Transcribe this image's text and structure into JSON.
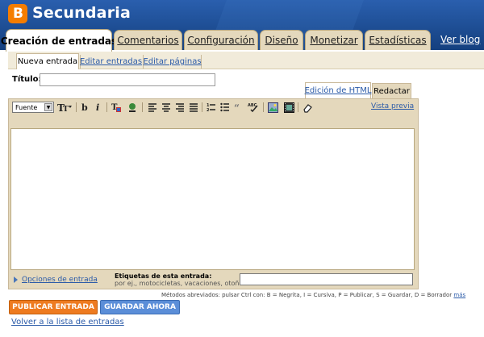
{
  "header": {
    "title": "Secundaria",
    "logo_letter": "B",
    "tabs": [
      {
        "label": "Creación de entradas"
      },
      {
        "label": "Comentarios"
      },
      {
        "label": "Configuración"
      },
      {
        "label": "Diseño"
      },
      {
        "label": "Monetizar"
      },
      {
        "label": "Estadísticas"
      }
    ],
    "view_blog": "Ver blog"
  },
  "subtabs": [
    {
      "label": "Nueva entrada"
    },
    {
      "label": "Editar entradas"
    },
    {
      "label": "Editar páginas"
    }
  ],
  "form": {
    "title_label": "Título:",
    "title_value": ""
  },
  "editor": {
    "mode_tabs": [
      "Edición de HTML",
      "Redactar"
    ],
    "font_select": "Fuente",
    "preview_link": "Vista previa",
    "toolbar_icons": [
      "text-size-icon",
      "bold-icon",
      "italic-icon",
      "text-color-icon",
      "highlight-icon",
      "align-left-icon",
      "align-center-icon",
      "align-right-icon",
      "justify-icon",
      "numbered-list-icon",
      "bullet-list-icon",
      "blockquote-icon",
      "spellcheck-icon",
      "image-icon",
      "video-icon",
      "eraser-icon"
    ]
  },
  "options": {
    "toggle_label": "Opciones de entrada",
    "labels_title": "Etiquetas de esta entrada:",
    "labels_hint": "por ej., motocicletas, vacaciones, otoño",
    "labels_value": ""
  },
  "shortcuts": {
    "text": "Métodos abreviados: pulsar Ctrl con: B = Negrita, I = Cursiva, P = Publicar, S = Guardar, D = Borrador",
    "more": "más"
  },
  "actions": {
    "publish": "PUBLICAR ENTRADA",
    "save": "GUARDAR AHORA",
    "back": "Volver a la lista de entradas"
  },
  "colors": {
    "header_blue": "#1a4d9b",
    "tab_beige": "#e4d8bc",
    "publish_orange": "#ee7b20",
    "save_blue": "#5b8ed8",
    "link_blue": "#2a5aa8"
  }
}
